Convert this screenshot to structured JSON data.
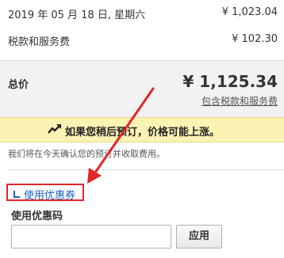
{
  "summary": {
    "date_label": "2019 年 05 月 18 日, 星期六",
    "date_amount": "¥ 1,023.04",
    "tax_label": "税款和服务费",
    "tax_amount": "¥ 102.30"
  },
  "total": {
    "label": "总价",
    "amount": "¥ 1,125.34",
    "sub": "包含税款和服务费"
  },
  "warning": {
    "icon": "trending-up-icon",
    "text": "如果您稍后预订，价格可能上涨。"
  },
  "note": "我们将在今天确认您的预订并收取费用。",
  "coupon": {
    "link_icon": "corner-down-icon",
    "link_label": "使用优惠券",
    "code_label": "使用优惠码",
    "input_value": "",
    "apply_label": "应用"
  },
  "colors": {
    "highlight": "#e0262a",
    "link": "#1a62c4",
    "warning_bg": "#faf3b4"
  }
}
